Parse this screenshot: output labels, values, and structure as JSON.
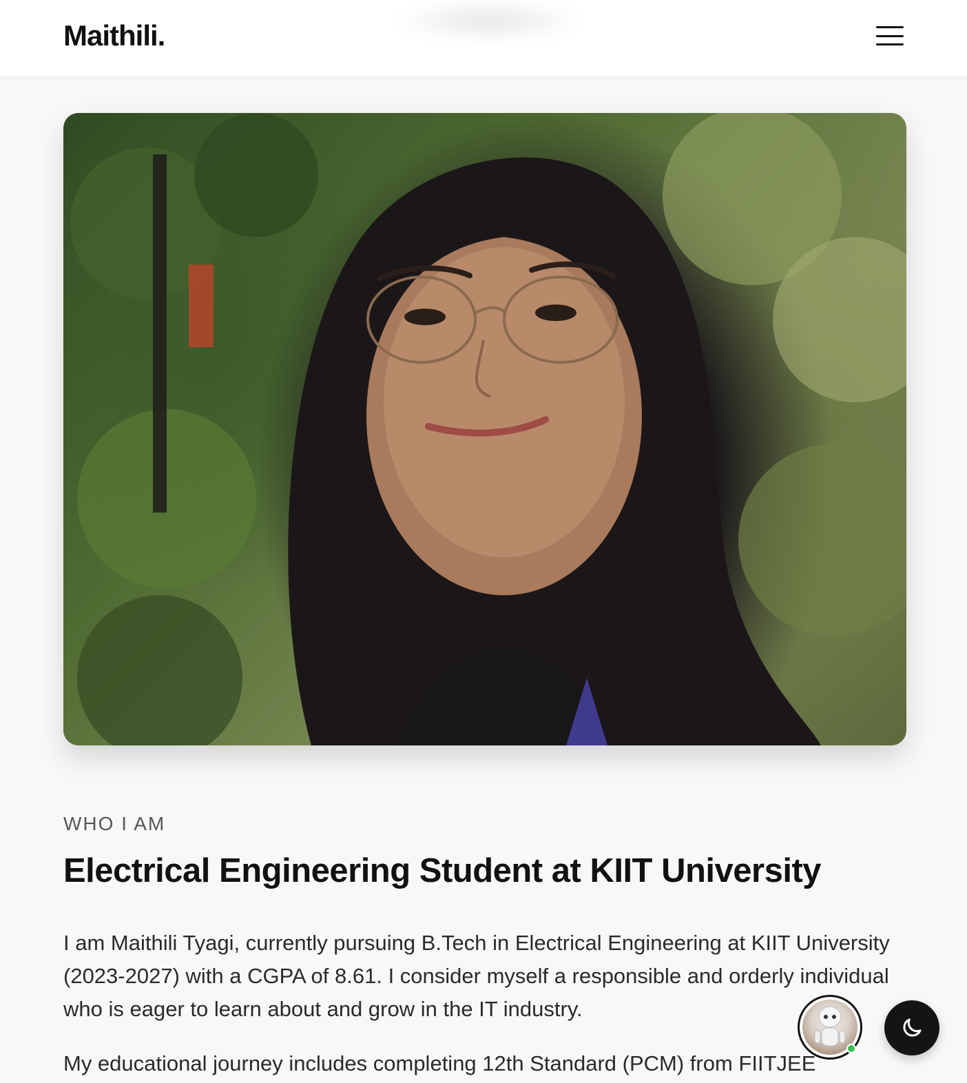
{
  "header": {
    "logo": "Maithili.",
    "menu_icon": "hamburger-menu-icon"
  },
  "hero": {
    "image_icon": "profile-photo"
  },
  "about": {
    "eyebrow": "WHO I AM",
    "headline": "Electrical Engineering Student at KIIT University",
    "paragraph_1": "I am Maithili Tyagi, currently pursuing B.Tech in Electrical Engineering at KIIT University (2023-2027) with a CGPA of 8.61. I consider myself a responsible and orderly individual who is eager to learn about and grow in the IT industry.",
    "paragraph_2": "My educational journey includes completing 12th Standard (PCM) from FIITJEE"
  },
  "floating": {
    "chat_icon": "robot-avatar-icon",
    "theme_icon": "moon-icon"
  },
  "colors": {
    "background": "#f8f8f8",
    "header_bg": "#ffffff",
    "text_primary": "#111111",
    "theme_button": "#141414",
    "online_dot": "#3bbf5a"
  }
}
